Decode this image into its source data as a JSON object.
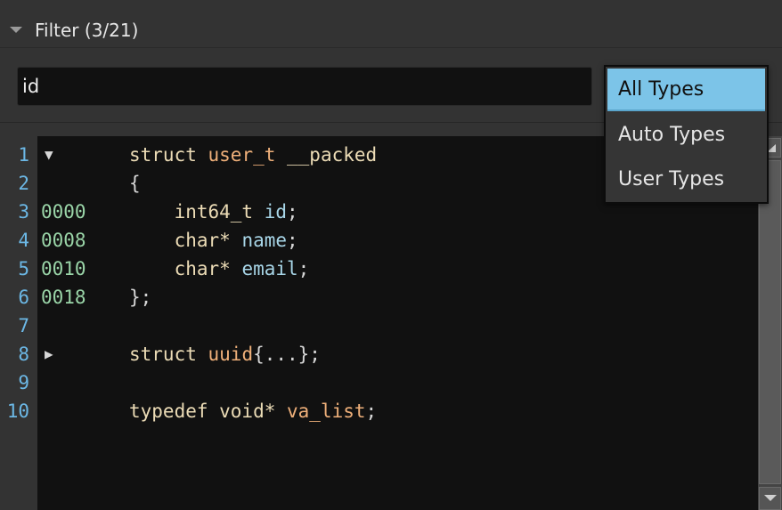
{
  "header": {
    "title": "Filter (3/21)"
  },
  "filter": {
    "value": "id",
    "placeholder": ""
  },
  "type_dropdown": {
    "options": [
      "All Types",
      "Auto Types",
      "User Types"
    ],
    "selected": "All Types"
  },
  "code": {
    "lines": [
      {
        "num": "1",
        "offset": "",
        "fold": "▼",
        "tokens": [
          {
            "t": "struct ",
            "c": "kw"
          },
          {
            "t": "user_t",
            "c": "ty"
          },
          {
            "t": " __packed",
            "c": "kw"
          }
        ]
      },
      {
        "num": "2",
        "offset": "",
        "fold": "",
        "tokens": [
          {
            "t": "{",
            "c": "pu"
          }
        ]
      },
      {
        "num": "3",
        "offset": "0000",
        "fold": "",
        "tokens": [
          {
            "t": "    int64_t ",
            "c": "kw"
          },
          {
            "t": "id",
            "c": "id"
          },
          {
            "t": ";",
            "c": "pu"
          }
        ]
      },
      {
        "num": "4",
        "offset": "0008",
        "fold": "",
        "tokens": [
          {
            "t": "    char* ",
            "c": "kw"
          },
          {
            "t": "name",
            "c": "id"
          },
          {
            "t": ";",
            "c": "pu"
          }
        ]
      },
      {
        "num": "5",
        "offset": "0010",
        "fold": "",
        "tokens": [
          {
            "t": "    char* ",
            "c": "kw"
          },
          {
            "t": "email",
            "c": "id"
          },
          {
            "t": ";",
            "c": "pu"
          }
        ]
      },
      {
        "num": "6",
        "offset": "0018",
        "fold": "",
        "tokens": [
          {
            "t": "};",
            "c": "pu"
          }
        ]
      },
      {
        "num": "7",
        "offset": "",
        "fold": "",
        "tokens": []
      },
      {
        "num": "8",
        "offset": "",
        "fold": "▶",
        "tokens": [
          {
            "t": "struct ",
            "c": "kw"
          },
          {
            "t": "uuid",
            "c": "ty"
          },
          {
            "t": "{...};",
            "c": "pu"
          }
        ]
      },
      {
        "num": "9",
        "offset": "",
        "fold": "",
        "tokens": []
      },
      {
        "num": "10",
        "offset": "",
        "fold": "",
        "tokens": [
          {
            "t": "typedef void* ",
            "c": "kw"
          },
          {
            "t": "va_list",
            "c": "ty"
          },
          {
            "t": ";",
            "c": "pu"
          }
        ]
      }
    ]
  },
  "colors": {
    "keyword": "#ecdcb6",
    "type_name": "#efb07a",
    "identifier": "#a8d6e8",
    "line_number": "#6cb8e6",
    "offset": "#9ad5a8",
    "selection": "#7cc4e8"
  }
}
